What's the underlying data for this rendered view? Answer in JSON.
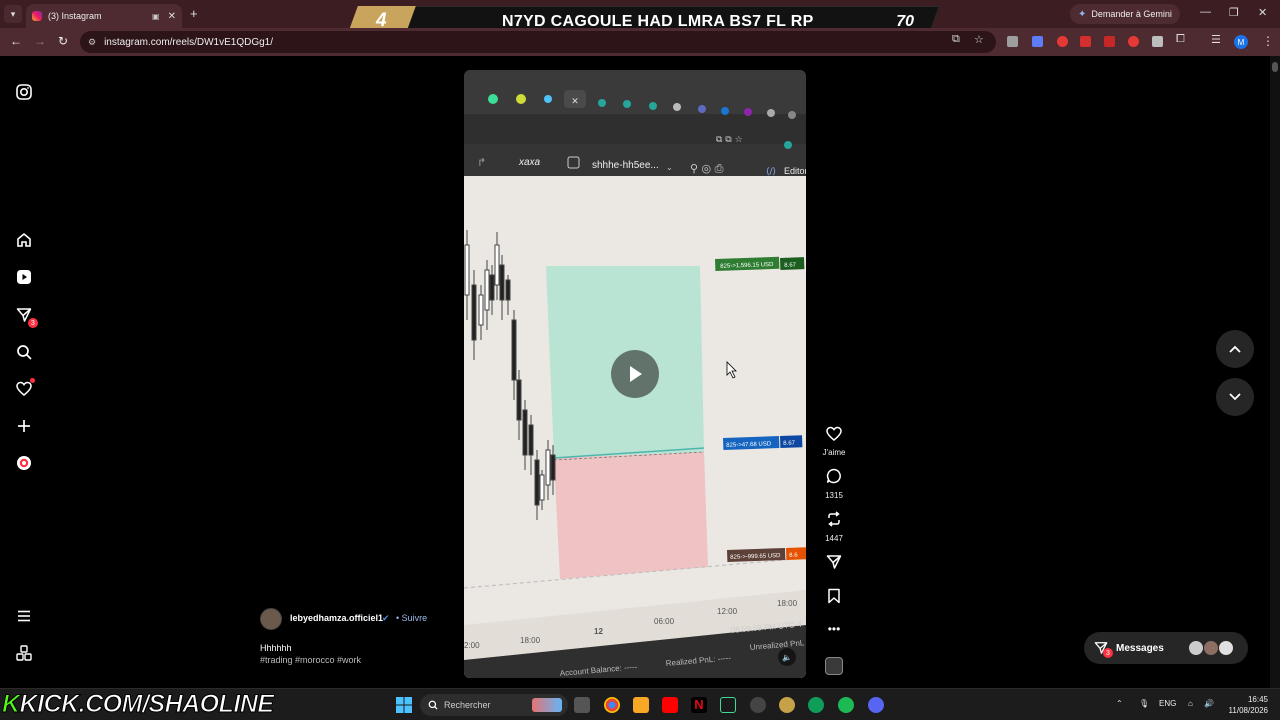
{
  "browser": {
    "tab_title": "(3) Instagram",
    "url": "instagram.com/reels/DW1vE1QDGg1/",
    "gemini_label": "Demander à Gemini",
    "profile_initial": "M"
  },
  "overlay": {
    "rank": "4",
    "headline": "N7YD CAGOULE HAD LMRA BS7 FL RP",
    "score": "70",
    "watermark_prefix": "K",
    "watermark_rest": "KICK.COM/SHAOLINE"
  },
  "sidebar": {
    "notifications_badge": "3"
  },
  "reel": {
    "username": "lebyedhamza.officiel1",
    "follow_label": "• Suivre",
    "description": "Hhhhhh",
    "hashtags": "#trading #morocco #work",
    "like_label": "J'aime",
    "comments_count": "1315",
    "reposts_count": "1447"
  },
  "video_content": {
    "browser_tab_text": "xaxa",
    "chart_name": "shhhe-hh5ee...",
    "editor_label": "Editor",
    "tp_label": "825->1,596.15 USD",
    "tp_value": "8.67",
    "entry_label": "825->47.68 USD",
    "entry_value": "8.67",
    "sl_label": "825->-999.65 USD",
    "sl_value": "8.6",
    "time_ticks": [
      "2:00",
      "18:00",
      "12",
      "06:00",
      "12:00",
      "18:00"
    ],
    "clock": "08:59:59 PM UTC-4",
    "account_balance": "Account Balance: -----",
    "realized_pnl": "Realized PnL: -----",
    "unrealized_pnl": "Unrealized PnL"
  },
  "messages": {
    "label": "Messages",
    "badge": "3"
  },
  "taskbar": {
    "search_label": "Rechercher",
    "language": "ENG",
    "time": "16:45",
    "date": "11/08/2026"
  },
  "colors": {
    "tab_bar": "#3b1d22",
    "toolbar": "#4e2b31",
    "tp_zone": "#b9e3d3",
    "sl_zone": "#efc3c3",
    "notification_red": "#ff3040",
    "kick_green": "#53fc18"
  }
}
